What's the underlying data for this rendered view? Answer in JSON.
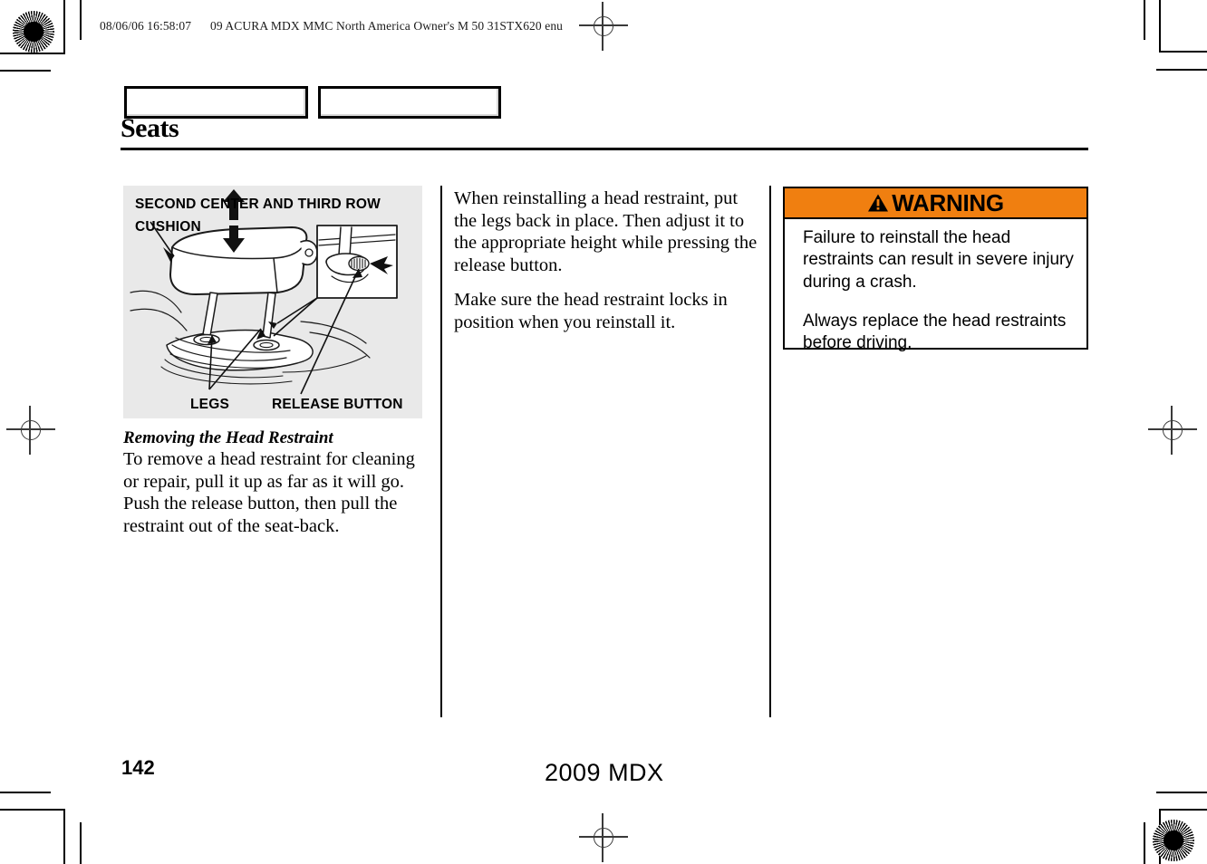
{
  "print_header": {
    "stamp": "08/06/06 16:58:07",
    "job": "09 ACURA MDX MMC North America Owner's M 50 31STX620 enu"
  },
  "tabs": [
    {
      "label": ""
    },
    {
      "label": ""
    }
  ],
  "section": {
    "title": "Seats"
  },
  "figure": {
    "labels": {
      "top_line1": "SECOND CENTER AND THIRD ROW",
      "top_line2": "CUSHION",
      "legs": "LEGS",
      "release_button": "RELEASE BUTTON"
    },
    "background_color": "#e9e9e9"
  },
  "column_left": {
    "heading": "Removing the Head Restraint",
    "paragraph": "To remove a head restraint for cleaning or repair, pull it up as far as it will go. Push the release button, then pull the restraint out of the seat-back."
  },
  "column_middle": {
    "paragraph1": "When reinstalling a head restraint, put the legs back in place. Then adjust it to the appropriate height while pressing the release button.",
    "paragraph2": "Make sure the head restraint locks in position when you reinstall it."
  },
  "warning": {
    "title": "WARNING",
    "paragraph1": "Failure to reinstall the head restraints can result in severe injury during a crash.",
    "paragraph2": "Always replace the head restraints before driving.",
    "header_color": "#F07F10"
  },
  "footer": {
    "page_number": "142",
    "model_year": "2009  MDX"
  }
}
